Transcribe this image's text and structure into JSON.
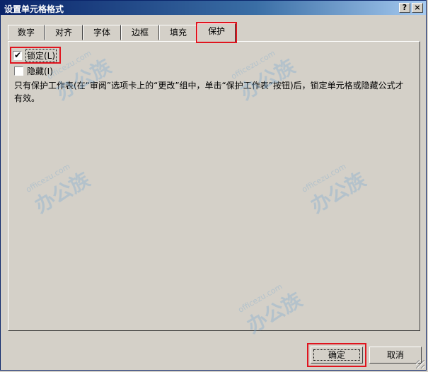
{
  "window": {
    "title": "设置单元格格式",
    "help_label": "?",
    "close_label": "×"
  },
  "tabs": [
    {
      "label": "数字"
    },
    {
      "label": "对齐"
    },
    {
      "label": "字体"
    },
    {
      "label": "边框"
    },
    {
      "label": "填充"
    },
    {
      "label": "保护",
      "active": true
    }
  ],
  "protection": {
    "locked": {
      "label": "锁定(L)",
      "checked": true,
      "mark": "✔"
    },
    "hidden": {
      "label": "隐藏(I)",
      "checked": false
    },
    "description": "只有保护工作表(在“审阅”选项卡上的“更改”组中，单击“保护工作表”按钮)后，锁定单元格或隐藏公式才有效。"
  },
  "buttons": {
    "ok": "确定",
    "cancel": "取消"
  },
  "watermark": {
    "text": "办公族",
    "site": "officezu.com"
  }
}
